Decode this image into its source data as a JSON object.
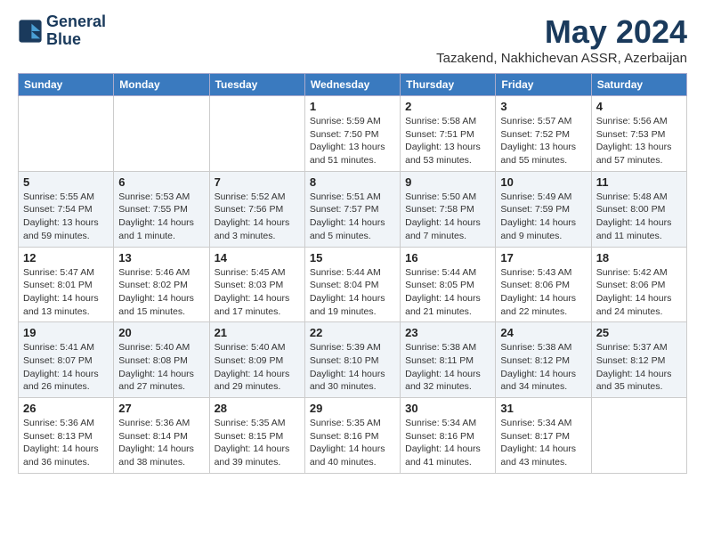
{
  "header": {
    "logo_line1": "General",
    "logo_line2": "Blue",
    "month_title": "May 2024",
    "location": "Tazakend, Nakhichevan ASSR, Azerbaijan"
  },
  "days_of_week": [
    "Sunday",
    "Monday",
    "Tuesday",
    "Wednesday",
    "Thursday",
    "Friday",
    "Saturday"
  ],
  "weeks": [
    {
      "days": [
        {
          "num": "",
          "info": ""
        },
        {
          "num": "",
          "info": ""
        },
        {
          "num": "",
          "info": ""
        },
        {
          "num": "1",
          "info": "Sunrise: 5:59 AM\nSunset: 7:50 PM\nDaylight: 13 hours\nand 51 minutes."
        },
        {
          "num": "2",
          "info": "Sunrise: 5:58 AM\nSunset: 7:51 PM\nDaylight: 13 hours\nand 53 minutes."
        },
        {
          "num": "3",
          "info": "Sunrise: 5:57 AM\nSunset: 7:52 PM\nDaylight: 13 hours\nand 55 minutes."
        },
        {
          "num": "4",
          "info": "Sunrise: 5:56 AM\nSunset: 7:53 PM\nDaylight: 13 hours\nand 57 minutes."
        }
      ]
    },
    {
      "days": [
        {
          "num": "5",
          "info": "Sunrise: 5:55 AM\nSunset: 7:54 PM\nDaylight: 13 hours\nand 59 minutes."
        },
        {
          "num": "6",
          "info": "Sunrise: 5:53 AM\nSunset: 7:55 PM\nDaylight: 14 hours\nand 1 minute."
        },
        {
          "num": "7",
          "info": "Sunrise: 5:52 AM\nSunset: 7:56 PM\nDaylight: 14 hours\nand 3 minutes."
        },
        {
          "num": "8",
          "info": "Sunrise: 5:51 AM\nSunset: 7:57 PM\nDaylight: 14 hours\nand 5 minutes."
        },
        {
          "num": "9",
          "info": "Sunrise: 5:50 AM\nSunset: 7:58 PM\nDaylight: 14 hours\nand 7 minutes."
        },
        {
          "num": "10",
          "info": "Sunrise: 5:49 AM\nSunset: 7:59 PM\nDaylight: 14 hours\nand 9 minutes."
        },
        {
          "num": "11",
          "info": "Sunrise: 5:48 AM\nSunset: 8:00 PM\nDaylight: 14 hours\nand 11 minutes."
        }
      ]
    },
    {
      "days": [
        {
          "num": "12",
          "info": "Sunrise: 5:47 AM\nSunset: 8:01 PM\nDaylight: 14 hours\nand 13 minutes."
        },
        {
          "num": "13",
          "info": "Sunrise: 5:46 AM\nSunset: 8:02 PM\nDaylight: 14 hours\nand 15 minutes."
        },
        {
          "num": "14",
          "info": "Sunrise: 5:45 AM\nSunset: 8:03 PM\nDaylight: 14 hours\nand 17 minutes."
        },
        {
          "num": "15",
          "info": "Sunrise: 5:44 AM\nSunset: 8:04 PM\nDaylight: 14 hours\nand 19 minutes."
        },
        {
          "num": "16",
          "info": "Sunrise: 5:44 AM\nSunset: 8:05 PM\nDaylight: 14 hours\nand 21 minutes."
        },
        {
          "num": "17",
          "info": "Sunrise: 5:43 AM\nSunset: 8:06 PM\nDaylight: 14 hours\nand 22 minutes."
        },
        {
          "num": "18",
          "info": "Sunrise: 5:42 AM\nSunset: 8:06 PM\nDaylight: 14 hours\nand 24 minutes."
        }
      ]
    },
    {
      "days": [
        {
          "num": "19",
          "info": "Sunrise: 5:41 AM\nSunset: 8:07 PM\nDaylight: 14 hours\nand 26 minutes."
        },
        {
          "num": "20",
          "info": "Sunrise: 5:40 AM\nSunset: 8:08 PM\nDaylight: 14 hours\nand 27 minutes."
        },
        {
          "num": "21",
          "info": "Sunrise: 5:40 AM\nSunset: 8:09 PM\nDaylight: 14 hours\nand 29 minutes."
        },
        {
          "num": "22",
          "info": "Sunrise: 5:39 AM\nSunset: 8:10 PM\nDaylight: 14 hours\nand 30 minutes."
        },
        {
          "num": "23",
          "info": "Sunrise: 5:38 AM\nSunset: 8:11 PM\nDaylight: 14 hours\nand 32 minutes."
        },
        {
          "num": "24",
          "info": "Sunrise: 5:38 AM\nSunset: 8:12 PM\nDaylight: 14 hours\nand 34 minutes."
        },
        {
          "num": "25",
          "info": "Sunrise: 5:37 AM\nSunset: 8:12 PM\nDaylight: 14 hours\nand 35 minutes."
        }
      ]
    },
    {
      "days": [
        {
          "num": "26",
          "info": "Sunrise: 5:36 AM\nSunset: 8:13 PM\nDaylight: 14 hours\nand 36 minutes."
        },
        {
          "num": "27",
          "info": "Sunrise: 5:36 AM\nSunset: 8:14 PM\nDaylight: 14 hours\nand 38 minutes."
        },
        {
          "num": "28",
          "info": "Sunrise: 5:35 AM\nSunset: 8:15 PM\nDaylight: 14 hours\nand 39 minutes."
        },
        {
          "num": "29",
          "info": "Sunrise: 5:35 AM\nSunset: 8:16 PM\nDaylight: 14 hours\nand 40 minutes."
        },
        {
          "num": "30",
          "info": "Sunrise: 5:34 AM\nSunset: 8:16 PM\nDaylight: 14 hours\nand 41 minutes."
        },
        {
          "num": "31",
          "info": "Sunrise: 5:34 AM\nSunset: 8:17 PM\nDaylight: 14 hours\nand 43 minutes."
        },
        {
          "num": "",
          "info": ""
        }
      ]
    }
  ]
}
